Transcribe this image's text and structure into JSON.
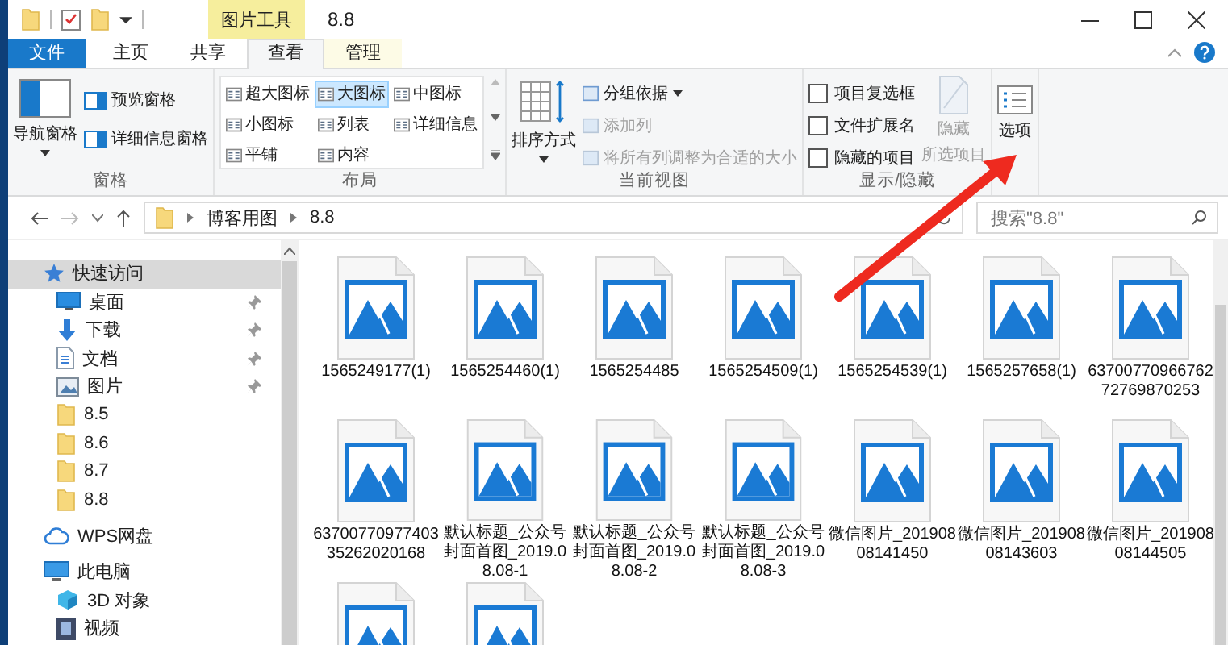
{
  "title_bar": {
    "context_tab": "图片工具",
    "title": "8.8"
  },
  "ribbon_tabs": [
    {
      "label": "文件",
      "kind": "file",
      "selected": false
    },
    {
      "label": "主页",
      "kind": "tab",
      "selected": false
    },
    {
      "label": "共享",
      "kind": "tab",
      "selected": false
    },
    {
      "label": "查看",
      "kind": "tab",
      "selected": true
    },
    {
      "label": "管理",
      "kind": "context",
      "selected": false
    }
  ],
  "panes_group": {
    "label": "窗格",
    "nav_pane": "导航窗格",
    "buttons": [
      "预览窗格",
      "详细信息窗格"
    ]
  },
  "layout_group": {
    "label": "布局",
    "options": [
      {
        "label": "超大图标",
        "selected": false
      },
      {
        "label": "大图标",
        "selected": true
      },
      {
        "label": "中图标",
        "selected": false
      },
      {
        "label": "小图标",
        "selected": false
      },
      {
        "label": "列表",
        "selected": false
      },
      {
        "label": "详细信息",
        "selected": false
      },
      {
        "label": "平铺",
        "selected": false
      },
      {
        "label": "内容",
        "selected": false
      }
    ]
  },
  "view_group": {
    "label": "当前视图",
    "sort": "排序方式",
    "commands": [
      {
        "label": "分组依据",
        "disabled": false
      },
      {
        "label": "添加列",
        "disabled": true
      },
      {
        "label": "将所有列调整为合适的大小",
        "disabled": true
      }
    ]
  },
  "show_hide_group": {
    "label": "显示/隐藏",
    "checkboxes": [
      {
        "label": "项目复选框",
        "checked": false
      },
      {
        "label": "文件扩展名",
        "checked": false
      },
      {
        "label": "隐藏的项目",
        "checked": false
      }
    ],
    "hide_button": {
      "lines": [
        "隐藏",
        "所选项目"
      ],
      "disabled": true
    }
  },
  "options_button": "选项",
  "address": {
    "path": [
      "博客用图",
      "8.8"
    ],
    "search_placeholder": "搜索\"8.8\""
  },
  "nav": [
    {
      "label": "快速访问",
      "kind": "star",
      "selected": true,
      "pinned": false,
      "children": [
        {
          "label": "桌面",
          "kind": "desktop",
          "selected": false,
          "pinned": true
        },
        {
          "label": "下载",
          "kind": "download",
          "selected": false,
          "pinned": true
        },
        {
          "label": "文档",
          "kind": "document",
          "selected": false,
          "pinned": true
        },
        {
          "label": "图片",
          "kind": "pictures",
          "selected": false,
          "pinned": true
        },
        {
          "label": "8.5",
          "kind": "folder",
          "selected": false,
          "pinned": false
        },
        {
          "label": "8.6",
          "kind": "folder",
          "selected": false,
          "pinned": false
        },
        {
          "label": "8.7",
          "kind": "folder",
          "selected": false,
          "pinned": false
        },
        {
          "label": "8.8",
          "kind": "folder",
          "selected": false,
          "pinned": false
        }
      ]
    },
    {
      "label": "WPS网盘",
      "kind": "cloud",
      "selected": false,
      "pinned": false
    },
    {
      "label": "此电脑",
      "kind": "pc",
      "selected": false,
      "pinned": false,
      "children": [
        {
          "label": "3D 对象",
          "kind": "cube",
          "selected": false,
          "pinned": false
        },
        {
          "label": "视频",
          "kind": "video",
          "selected": false,
          "pinned": false
        }
      ]
    }
  ],
  "files": [
    {
      "kind": "image",
      "name": "1565249177(1)"
    },
    {
      "kind": "image",
      "name": "1565254460(1)"
    },
    {
      "kind": "image",
      "name": "1565254485"
    },
    {
      "kind": "image",
      "name": "1565254509(1)"
    },
    {
      "kind": "image",
      "name": "1565254539(1)"
    },
    {
      "kind": "image",
      "name": "1565257658(1)"
    },
    {
      "kind": "image",
      "name": "6370077096676272769870253"
    },
    {
      "kind": "image",
      "name": "6370077097740335262020168"
    },
    {
      "kind": "image",
      "name": "默认标题_公众号封面首图_2019.08.08-1"
    },
    {
      "kind": "image",
      "name": "默认标题_公众号封面首图_2019.08.08-2"
    },
    {
      "kind": "image",
      "name": "默认标题_公众号封面首图_2019.08.08-3"
    },
    {
      "kind": "image",
      "name": "微信图片_20190808141450"
    },
    {
      "kind": "image",
      "name": "微信图片_20190808143603"
    },
    {
      "kind": "image",
      "name": "微信图片_20190808144505"
    },
    {
      "kind": "image"
    },
    {
      "kind": "image"
    }
  ]
}
